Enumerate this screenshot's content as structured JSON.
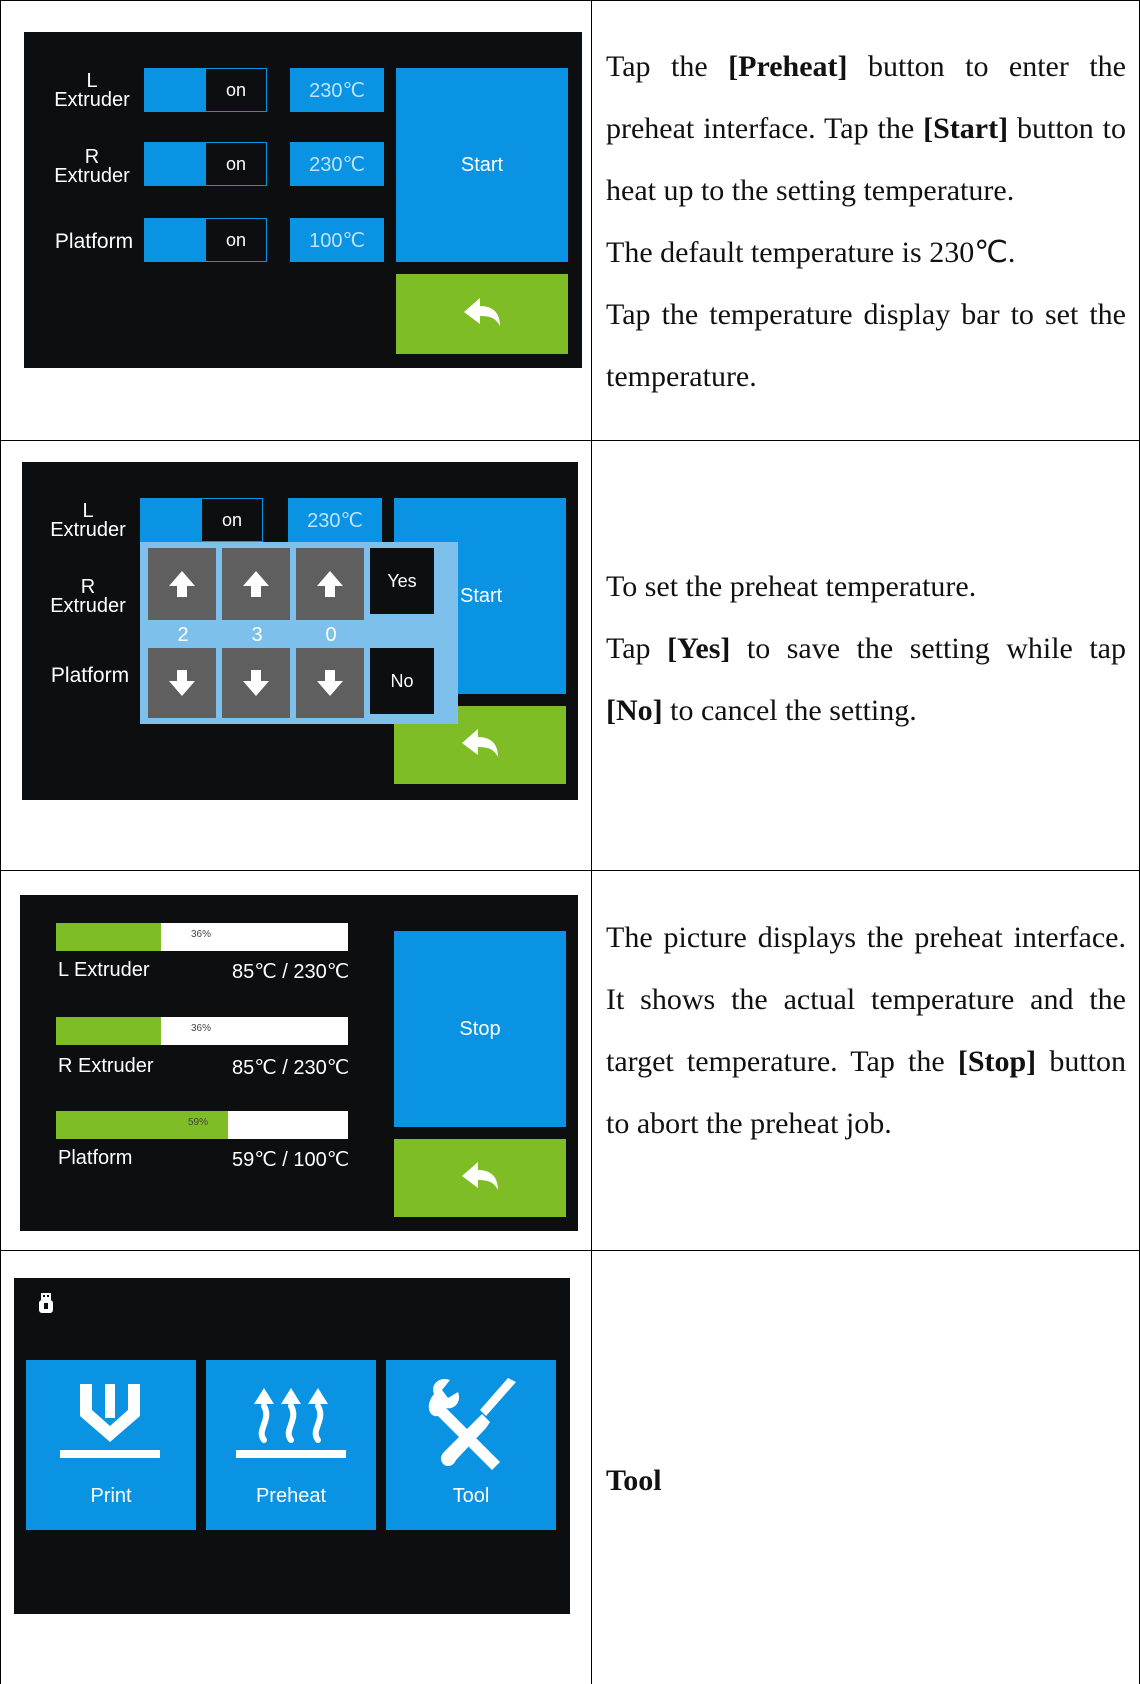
{
  "row1": {
    "screen": {
      "rows": [
        {
          "label_top": "L",
          "label_bottom": "Extruder",
          "toggle": "on",
          "temp": "230℃"
        },
        {
          "label_top": "R",
          "label_bottom": "Extruder",
          "toggle": "on",
          "temp": "230℃"
        },
        {
          "label_top": "",
          "label_bottom": "Platform",
          "toggle": "on",
          "temp": "100℃"
        }
      ],
      "start_label": "Start"
    },
    "desc": {
      "p1_a": "Tap the ",
      "p1_b": "[Preheat]",
      "p1_c": " button to enter the preheat interface. Tap the ",
      "p1_d": "[Start]",
      "p1_e": " button to heat up to the setting temperature.",
      "p2": "The default temperature is 230℃.",
      "p3": "Tap the temperature display bar to set the temperature."
    }
  },
  "row2": {
    "screen": {
      "l_top": "L",
      "l_bottom": "Extruder",
      "l_toggle": "on",
      "l_temp": "230℃",
      "r_top": "R",
      "r_bottom": "Extruder",
      "platform": "Platform",
      "start_partial": "Start",
      "digits": [
        "2",
        "3",
        "0"
      ],
      "yes": "Yes",
      "no": "No"
    },
    "desc": {
      "p1": "To set the preheat temperature.",
      "p2_a": "Tap ",
      "p2_b": "[Yes]",
      "p2_c": " to save the setting while tap ",
      "p2_d": "[No]",
      "p2_e": " to cancel the setting."
    }
  },
  "row3": {
    "screen": {
      "items": [
        {
          "name": "L Extruder",
          "value": "85℃ / 230℃",
          "percent": "36%",
          "progress": 0.36
        },
        {
          "name": "R Extruder",
          "value": "85℃ / 230℃",
          "percent": "36%",
          "progress": 0.36
        },
        {
          "name": "Platform",
          "value": "59℃ / 100℃",
          "percent": "59%",
          "progress": 0.59
        }
      ],
      "stop_label": "Stop"
    },
    "desc": {
      "p1": "The picture displays the preheat interface. It shows the actual temperature and the target temperature. Tap the ",
      "p1_b": "[Stop]",
      "p1_c": " button to abort the preheat job."
    }
  },
  "row4": {
    "screen": {
      "tiles": [
        "Print",
        "Preheat",
        "Tool"
      ]
    },
    "desc": {
      "title": "Tool"
    }
  },
  "colors": {
    "blue": "#0a93e2",
    "green": "#7fbd26",
    "screen_bg": "#0d0e10",
    "panel": "#7ec0ec"
  }
}
